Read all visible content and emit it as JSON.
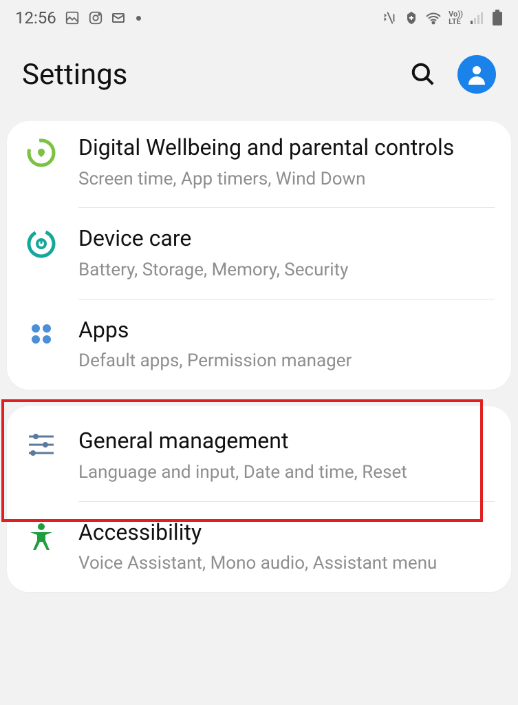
{
  "statusbar": {
    "time": "12:56"
  },
  "header": {
    "title": "Settings"
  },
  "groups": [
    {
      "items": [
        {
          "id": "wellbeing",
          "title": "Digital Wellbeing and parental controls",
          "subtitle": "Screen time, App timers, Wind Down"
        },
        {
          "id": "devicecare",
          "title": "Device care",
          "subtitle": "Battery, Storage, Memory, Security"
        },
        {
          "id": "apps",
          "title": "Apps",
          "subtitle": "Default apps, Permission manager"
        }
      ]
    },
    {
      "items": [
        {
          "id": "general",
          "title": "General management",
          "subtitle": "Language and input, Date and time, Reset"
        },
        {
          "id": "accessibility",
          "title": "Accessibility",
          "subtitle": "Voice Assistant, Mono audio, Assistant menu"
        }
      ]
    }
  ]
}
